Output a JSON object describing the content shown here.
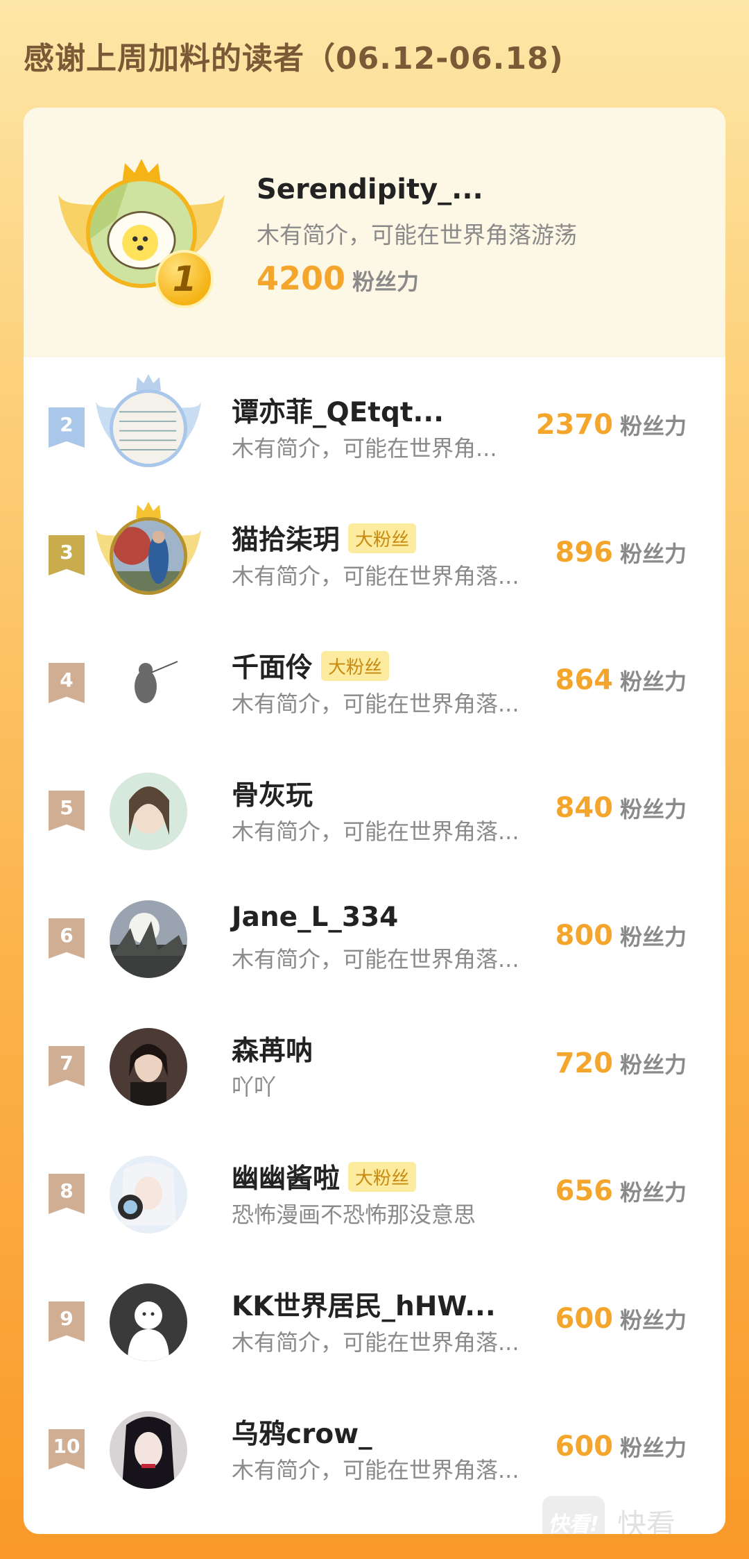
{
  "header": {
    "title": "感谢上周加料的读者（06.12-06.18)"
  },
  "score_label": "粉丝力",
  "fan_badge_label": "大粉丝",
  "first_place": {
    "rank": "1",
    "name": "Serendipity_...",
    "bio": "木有简介，可能在世界角落游荡",
    "score": "4200"
  },
  "rows": [
    {
      "rank": "2",
      "name": "谭亦菲_QEtqt...",
      "bio": "木有简介，可能在世界角...",
      "score": "2370",
      "badge": ""
    },
    {
      "rank": "3",
      "name": "猫拾柒玥",
      "bio": "木有简介，可能在世界角落...",
      "score": "896",
      "badge": "大粉丝"
    },
    {
      "rank": "4",
      "name": "千面伶",
      "bio": "木有简介，可能在世界角落...",
      "score": "864",
      "badge": "大粉丝"
    },
    {
      "rank": "5",
      "name": "骨灰玩",
      "bio": "木有简介，可能在世界角落...",
      "score": "840",
      "badge": ""
    },
    {
      "rank": "6",
      "name": "Jane_L_334",
      "bio": "木有简介，可能在世界角落...",
      "score": "800",
      "badge": ""
    },
    {
      "rank": "7",
      "name": "森苒呐",
      "bio": "吖吖",
      "score": "720",
      "badge": ""
    },
    {
      "rank": "8",
      "name": "幽幽酱啦",
      "bio": "恐怖漫画不恐怖那没意思",
      "score": "656",
      "badge": "大粉丝"
    },
    {
      "rank": "9",
      "name": "KK世界居民_hHW...",
      "bio": "木有简介，可能在世界角落...",
      "score": "600",
      "badge": ""
    },
    {
      "rank": "10",
      "name": "乌鸦crow_",
      "bio": "木有简介，可能在世界角落...",
      "score": "600",
      "badge": ""
    }
  ],
  "watermark": {
    "logo": "快看!",
    "text": "快看"
  },
  "colors": {
    "score": "#f4a52b",
    "rank2_flag": "#a9c7e8",
    "rank3_flag": "#c8ac4e",
    "rank_other_flag": "#cfae94",
    "fan_badge_bg": "#fdeba0"
  }
}
